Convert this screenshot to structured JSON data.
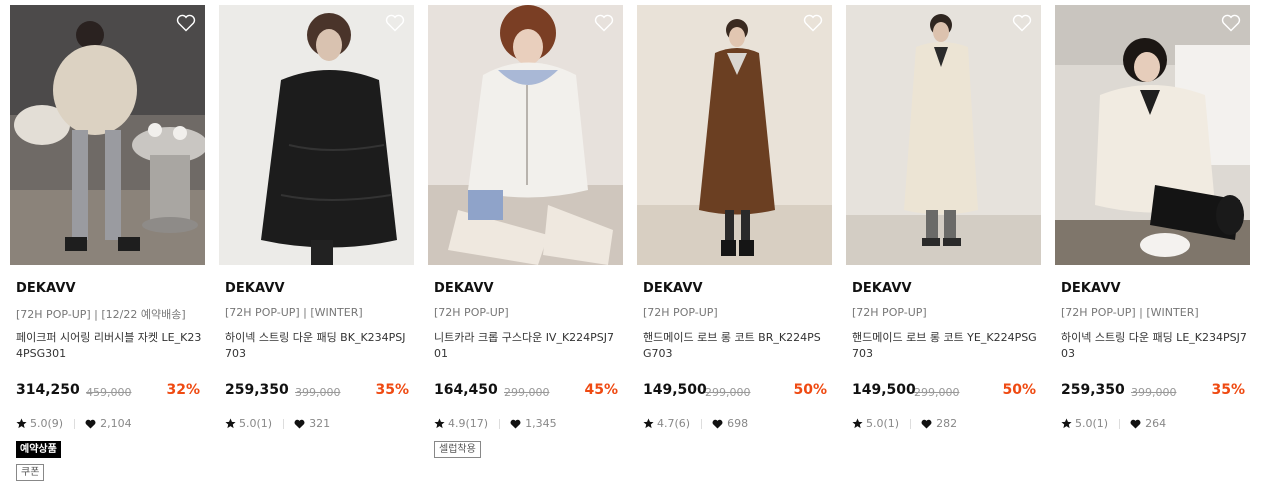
{
  "colors": {
    "discount": "#ef4a12",
    "text": "#111111",
    "muted": "#888888",
    "strike": "#999999",
    "badge_bg": "#000000"
  },
  "products": [
    {
      "brand": "DEKAVV",
      "tags": "[72H POP-UP] | [12/22 예약배송]",
      "name": "페이크퍼 시어링 리버시블 자켓 LE_K234PSG301",
      "price": "314,250",
      "original_price": "459,000",
      "discount": "32%",
      "rating": "5.0(9)",
      "likes": "2,104",
      "badges": [
        "예약상품"
      ],
      "outline_badges": [
        "쿠폰"
      ],
      "image_icon": "photo-fur-jacket"
    },
    {
      "brand": "DEKAVV",
      "tags": "[72H POP-UP] | [WINTER]",
      "name": "하이넥 스트링 다운 패딩 BK_K234PSJ703",
      "price": "259,350",
      "original_price": "399,000",
      "discount": "35%",
      "rating": "5.0(1)",
      "likes": "321",
      "badges": [],
      "outline_badges": [],
      "image_icon": "photo-black-padding"
    },
    {
      "brand": "DEKAVV",
      "tags": "[72H POP-UP]",
      "name": "니트카라 크롭 구스다운 IV_K224PSJ701",
      "price": "164,450",
      "original_price": "299,000",
      "discount": "45%",
      "rating": "4.9(17)",
      "likes": "1,345",
      "badges": [],
      "outline_badges": [
        "셀럽착용"
      ],
      "image_icon": "photo-ivory-down"
    },
    {
      "brand": "DEKAVV",
      "tags": "[72H POP-UP]",
      "name": "핸드메이드 로브 롱 코트 BR_K224PSG703",
      "price": "149,500",
      "original_price": "299,000",
      "discount": "50%",
      "rating": "4.7(6)",
      "likes": "698",
      "badges": [],
      "outline_badges": [],
      "image_icon": "photo-brown-coat"
    },
    {
      "brand": "DEKAVV",
      "tags": "[72H POP-UP]",
      "name": "핸드메이드 로브 롱 코트 YE_K224PSG703",
      "price": "149,500",
      "original_price": "299,000",
      "discount": "50%",
      "rating": "5.0(1)",
      "likes": "282",
      "badges": [],
      "outline_badges": [],
      "image_icon": "photo-cream-coat"
    },
    {
      "brand": "DEKAVV",
      "tags": "[72H POP-UP] | [WINTER]",
      "name": "하이넥 스트링 다운 패딩 LE_K234PSJ703",
      "price": "259,350",
      "original_price": "399,000",
      "discount": "35%",
      "rating": "5.0(1)",
      "likes": "264",
      "badges": [],
      "outline_badges": [],
      "image_icon": "photo-cream-padding"
    }
  ]
}
